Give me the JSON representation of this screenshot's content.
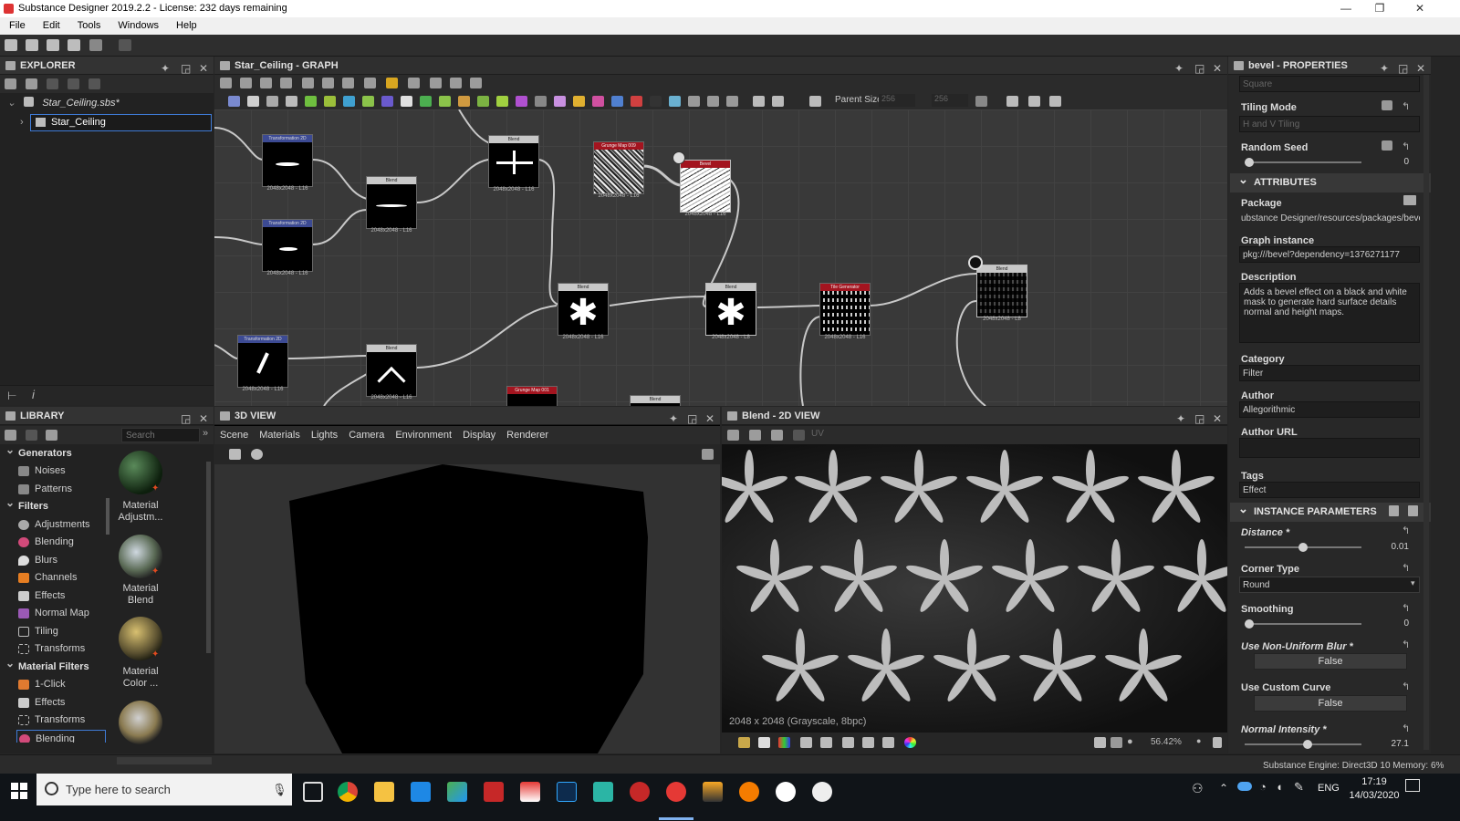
{
  "window": {
    "title": "Substance Designer 2019.2.2 - License: 232 days remaining"
  },
  "menu": [
    "File",
    "Edit",
    "Tools",
    "Windows",
    "Help"
  ],
  "explorer": {
    "title": "EXPLORER",
    "package": "Star_Ceiling.sbs*",
    "graph": "Star_Ceiling"
  },
  "graph_panel": {
    "title": "Star_Ceiling - GRAPH",
    "parent_size_label": "Parent Size:",
    "parent_size_w": "256",
    "parent_size_h": "256",
    "nodes": [
      {
        "title": "Transformation 2D",
        "size": "2048x2048 - L16"
      },
      {
        "title": "Transformation 2D",
        "size": "2048x2048 - L16"
      },
      {
        "title": "Blend",
        "size": "2048x2048 - L16"
      },
      {
        "title": "Blend",
        "size": "2048x2048 - L16"
      },
      {
        "title": "Grunge Map 009",
        "size": "2048x2048 - L16"
      },
      {
        "title": "Bevel",
        "size": "2048x2048 - L16"
      },
      {
        "title": "Transformation 2D",
        "size": "2048x2048 - L16"
      },
      {
        "title": "Blend",
        "size": "2048x2048 - L16"
      },
      {
        "title": "Blend",
        "size": "2048x2048 - L16"
      },
      {
        "title": "Blend",
        "size": "2048x2048 - L8"
      },
      {
        "title": "Tile Generator",
        "size": "2048x2048 - L16"
      },
      {
        "title": "Blend",
        "size": "2048x2048 - L8"
      },
      {
        "title": "Grunge Map 001",
        "size": ""
      },
      {
        "title": "Blend",
        "size": ""
      }
    ]
  },
  "library": {
    "title": "LIBRARY",
    "search_placeholder": "Search",
    "tree": [
      {
        "label": "Generators",
        "type": "cat"
      },
      {
        "label": "Noises",
        "type": "item"
      },
      {
        "label": "Patterns",
        "type": "item"
      },
      {
        "label": "Filters",
        "type": "cat"
      },
      {
        "label": "Adjustments",
        "type": "item"
      },
      {
        "label": "Blending",
        "type": "item"
      },
      {
        "label": "Blurs",
        "type": "item"
      },
      {
        "label": "Channels",
        "type": "item"
      },
      {
        "label": "Effects",
        "type": "item"
      },
      {
        "label": "Normal Map",
        "type": "item"
      },
      {
        "label": "Tiling",
        "type": "item"
      },
      {
        "label": "Transforms",
        "type": "item"
      },
      {
        "label": "Material Filters",
        "type": "cat"
      },
      {
        "label": "1-Click",
        "type": "item"
      },
      {
        "label": "Effects",
        "type": "item"
      },
      {
        "label": "Transforms",
        "type": "item"
      },
      {
        "label": "Blending",
        "type": "item"
      }
    ],
    "thumbs": [
      "Material Adjustm...",
      "Material Blend",
      "Material Color ..."
    ]
  },
  "view3d": {
    "title": "3D VIEW",
    "menu": [
      "Scene",
      "Materials",
      "Lights",
      "Camera",
      "Environment",
      "Display",
      "Renderer"
    ]
  },
  "view2d": {
    "title": "Blend - 2D VIEW",
    "uv_label": "UV",
    "info": "2048 x 2048 (Grayscale, 8bpc)",
    "zoom": "56.42%"
  },
  "properties": {
    "title": "bevel - PROPERTIES",
    "output_size_value": "Square",
    "tiling_mode_label": "Tiling Mode",
    "tiling_mode_value": "H and V Tiling",
    "random_seed_label": "Random Seed",
    "random_seed_value": "0",
    "attributes_title": "ATTRIBUTES",
    "package_label": "Package",
    "package_value": "ubstance Designer/resources/packages/bevel.sbs",
    "graph_instance_label": "Graph instance",
    "graph_instance_value": "pkg:///bevel?dependency=1376271177",
    "description_label": "Description",
    "description_value": "Adds a bevel effect on a black and white mask to generate hard surface details normal and height maps.",
    "category_label": "Category",
    "category_value": "Filter",
    "author_label": "Author",
    "author_value": "Allegorithmic",
    "author_url_label": "Author URL",
    "author_url_value": "",
    "tags_label": "Tags",
    "tags_value": "Effect",
    "instance_title": "INSTANCE PARAMETERS",
    "distance_label": "Distance *",
    "distance_value": "0.01",
    "distance_fraction": 0.5,
    "corner_type_label": "Corner Type",
    "corner_type_value": "Round",
    "smoothing_label": "Smoothing",
    "smoothing_value": "0",
    "non_uniform_label": "Use Non-Uniform Blur *",
    "non_uniform_value": "False",
    "custom_curve_label": "Use Custom Curve",
    "custom_curve_value": "False",
    "normal_intensity_label": "Normal Intensity *",
    "normal_intensity_value": "27.1"
  },
  "status": {
    "engine": "Substance Engine: Direct3D 10  Memory: 6%"
  },
  "taskbar": {
    "search_placeholder": "Type here to search",
    "lang": "ENG",
    "time": "17:19",
    "date": "14/03/2020"
  }
}
